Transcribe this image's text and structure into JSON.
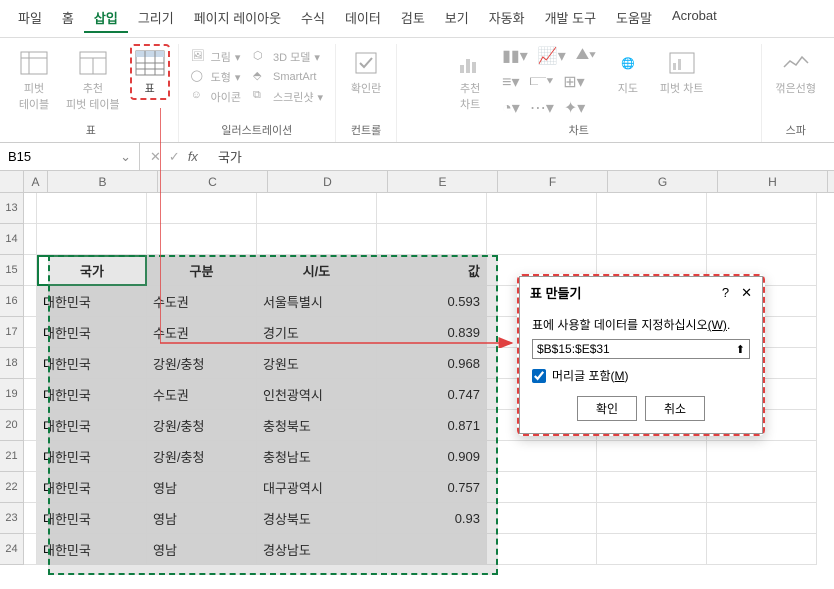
{
  "menubar": [
    "파일",
    "홈",
    "삽입",
    "그리기",
    "페이지 레이아웃",
    "수식",
    "데이터",
    "검토",
    "보기",
    "자동화",
    "개발 도구",
    "도움말",
    "Acrobat"
  ],
  "menubar_active_index": 2,
  "ribbon": {
    "group_table": {
      "pivot": "피벗\n테이블",
      "rec_pivot": "추천\n피벗 테이블",
      "table": "표",
      "label": "표"
    },
    "group_illust": {
      "items": [
        "그림",
        "3D 모델",
        "도형",
        "SmartArt",
        "아이콘",
        "스크린샷"
      ],
      "label": "일러스트레이션"
    },
    "group_ctrl": {
      "checkbox": "확인란",
      "label": "컨트롤"
    },
    "group_chart": {
      "rec": "추천\n차트",
      "map": "지도",
      "pivot_chart": "피벗 차트",
      "label": "차트"
    },
    "group_spark": {
      "line": "꺾은선형",
      "label": "스파"
    }
  },
  "formula_bar": {
    "name_box": "B15",
    "value": "국가"
  },
  "columns": [
    "A",
    "B",
    "C",
    "D",
    "E",
    "F",
    "G",
    "H"
  ],
  "row_labels_empty": [
    "13",
    "14"
  ],
  "headers": [
    "국가",
    "구분",
    "시/도",
    "값"
  ],
  "rows": [
    {
      "r": "15",
      "v": [
        "국가",
        "구분",
        "시/도",
        "값"
      ],
      "hdr": true
    },
    {
      "r": "16",
      "v": [
        "대한민국",
        "수도권",
        "서울특별시",
        "0.593"
      ]
    },
    {
      "r": "17",
      "v": [
        "대한민국",
        "수도권",
        "경기도",
        "0.839"
      ]
    },
    {
      "r": "18",
      "v": [
        "대한민국",
        "강원/충청",
        "강원도",
        "0.968"
      ]
    },
    {
      "r": "19",
      "v": [
        "대한민국",
        "수도권",
        "인천광역시",
        "0.747"
      ]
    },
    {
      "r": "20",
      "v": [
        "대한민국",
        "강원/충청",
        "충청북도",
        "0.871"
      ]
    },
    {
      "r": "21",
      "v": [
        "대한민국",
        "강원/충청",
        "충청남도",
        "0.909"
      ]
    },
    {
      "r": "22",
      "v": [
        "대한민국",
        "영남",
        "대구광역시",
        "0.757"
      ]
    },
    {
      "r": "23",
      "v": [
        "대한민국",
        "영남",
        "경상북도",
        "0.93"
      ]
    },
    {
      "r": "24",
      "v": [
        "대한민국",
        "영남",
        "경상남도",
        ""
      ]
    }
  ],
  "dialog": {
    "title": "표 만들기",
    "msg": "표에 사용할 데이터를 지정하십시오",
    "msg_key": "(W)",
    "range": "$B$15:$E$31",
    "chk_label": "머리글 포함",
    "chk_key": "(M)",
    "ok": "확인",
    "cancel": "취소"
  }
}
